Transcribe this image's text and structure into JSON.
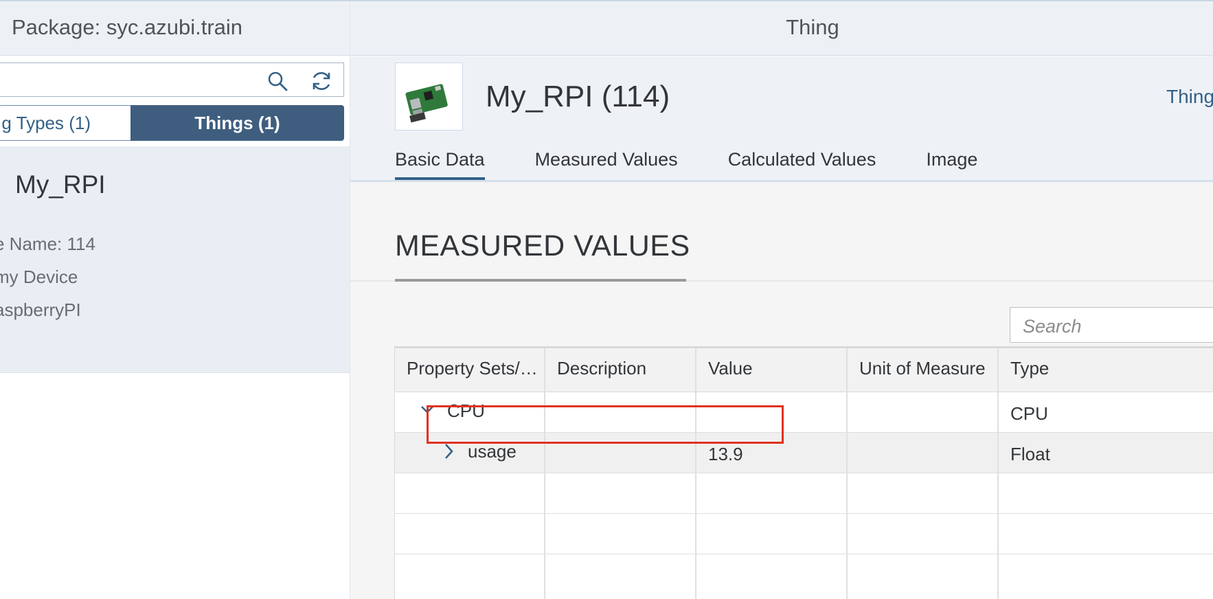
{
  "left_panel": {
    "package_title": "Package: syc.azubi.train",
    "segments": {
      "thing_types": "g Types (1)",
      "things": "Things (1)"
    },
    "selected_item": {
      "title": "My_RPI",
      "attributes": [
        "e Name: 114",
        "my Device",
        "aspberryPI"
      ]
    }
  },
  "right_panel": {
    "header_title": "Thing",
    "object": {
      "title": "My_RPI (114)",
      "link_text": "Thing"
    },
    "tabs": [
      "Basic Data",
      "Measured Values",
      "Calculated Values",
      "Image"
    ],
    "active_tab": "Basic Data",
    "section_title": "MEASURED VALUES",
    "search_placeholder": "Search",
    "table": {
      "columns": [
        "Property Sets/…",
        "Description",
        "Value",
        "Unit of Measure",
        "Type"
      ],
      "rows": [
        {
          "name": "CPU",
          "description": "",
          "value": "",
          "unit": "",
          "type": "CPU",
          "expanded": true
        },
        {
          "name": "usage",
          "description": "",
          "value": "13.9",
          "unit": "",
          "type": "Float",
          "expanded": false
        }
      ]
    }
  },
  "colors": {
    "accent": "#346187",
    "selected_segment": "#3f5e7f",
    "highlight": "#e0321c"
  }
}
